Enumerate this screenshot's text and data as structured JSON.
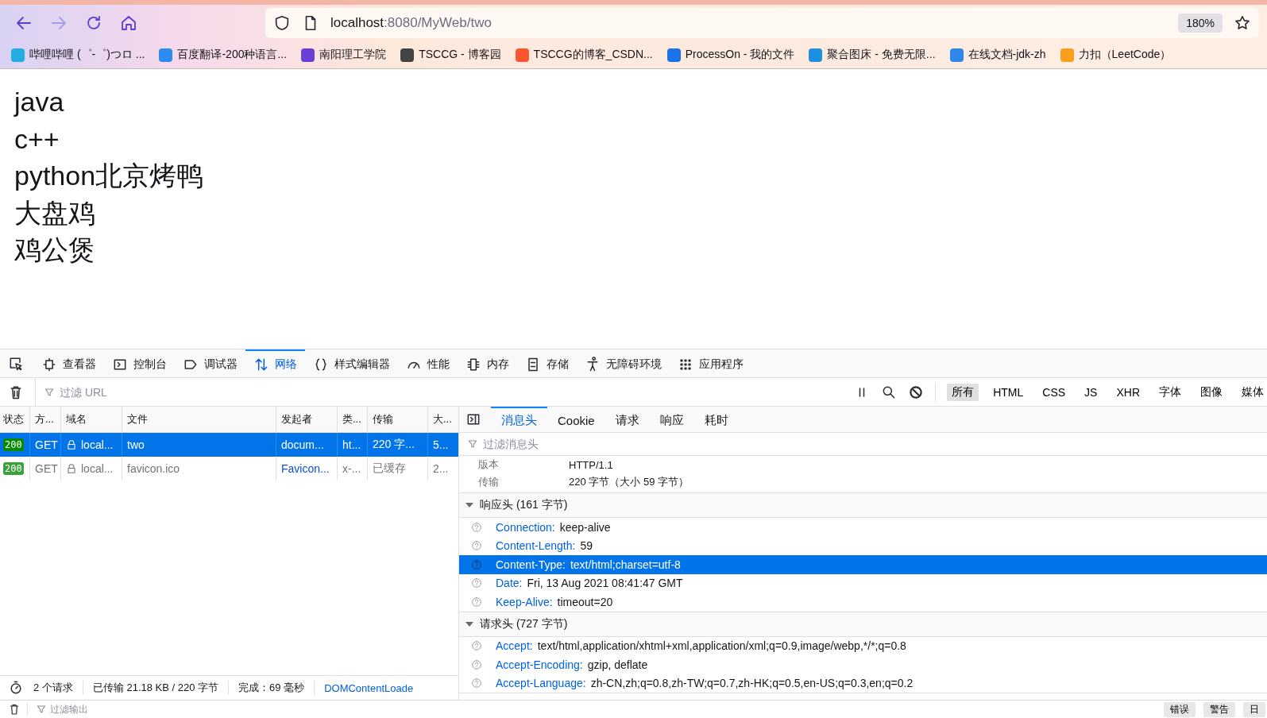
{
  "browser": {
    "nav": [
      {
        "kind": "back",
        "disabled": false
      },
      {
        "kind": "forward",
        "disabled": true
      },
      {
        "kind": "reload",
        "disabled": false
      },
      {
        "kind": "home",
        "disabled": false
      }
    ],
    "url": {
      "host": "localhost",
      "path": ":8080/MyWeb/two"
    },
    "zoom": "180%",
    "bookmarks": [
      "哔哩哔哩 (゜-゜)つロ ...",
      "百度翻译-200种语言...",
      "南阳理工学院",
      "TSCCG - 博客园",
      "TSCCG的博客_CSDN...",
      "ProcessOn - 我的文件",
      "聚合图床 - 免费无限...",
      "在线文档-jdk-zh",
      "力扣（LeetCode）"
    ]
  },
  "page": {
    "lines": [
      "java",
      "c++",
      "python北京烤鸭",
      "大盘鸡",
      "鸡公煲"
    ]
  },
  "devtools": {
    "tabs": [
      {
        "label": "查看器",
        "selected": false
      },
      {
        "label": "控制台",
        "selected": false
      },
      {
        "label": "调试器",
        "selected": false
      },
      {
        "label": "网络",
        "selected": true
      },
      {
        "label": "样式编辑器",
        "selected": false
      },
      {
        "label": "性能",
        "selected": false
      },
      {
        "label": "内存",
        "selected": false
      },
      {
        "label": "存储",
        "selected": false
      },
      {
        "label": "无障碍环境",
        "selected": false
      },
      {
        "label": "应用程序",
        "selected": false
      }
    ],
    "filter": {
      "placeholder": "过滤 URL"
    },
    "type_filters": [
      {
        "label": "所有",
        "selected": true
      },
      {
        "label": "HTML",
        "selected": false
      },
      {
        "label": "CSS",
        "selected": false
      },
      {
        "label": "JS",
        "selected": false
      },
      {
        "label": "XHR",
        "selected": false
      },
      {
        "label": "字体",
        "selected": false
      },
      {
        "label": "图像",
        "selected": false
      },
      {
        "label": "媒体",
        "selected": false
      }
    ],
    "columns": [
      "状态",
      "方...",
      "域名",
      "文件",
      "发起者",
      "类...",
      "传输",
      "大..."
    ],
    "requests": [
      {
        "status": "200",
        "method": "GET",
        "domain": "local...",
        "file": "two",
        "initiator": "docum...",
        "type": "ht...",
        "transfer": "220 字...",
        "size": "5...",
        "selected": true,
        "cached": false
      },
      {
        "status": "200",
        "method": "GET",
        "domain": "local...",
        "file": "favicon.ico",
        "initiator": "Favicon...",
        "type": "x-...",
        "transfer": "已缓存",
        "size": "2...",
        "selected": false,
        "cached": true
      }
    ],
    "status": {
      "requests": "2 个请求",
      "transferred": "已传输 21.18 KB / 220 字节",
      "finish": "完成：69 毫秒",
      "dom": "DOMContentLoade"
    },
    "details": {
      "tabs": [
        {
          "label": "消息头",
          "selected": true
        },
        {
          "label": "Cookie",
          "selected": false
        },
        {
          "label": "请求",
          "selected": false
        },
        {
          "label": "响应",
          "selected": false
        },
        {
          "label": "耗时",
          "selected": false
        }
      ],
      "filter": {
        "placeholder": "过滤消息头"
      },
      "summary": [
        {
          "label": "版本",
          "value": "HTTP/1.1"
        },
        {
          "label": "传输",
          "value": "220 字节（大小 59 字节）"
        }
      ],
      "sections": [
        {
          "title": "响应头 (161 字节)",
          "expanded": true,
          "headers": [
            {
              "name": "Connection:",
              "value": "keep-alive",
              "selected": false
            },
            {
              "name": "Content-Length:",
              "value": "59",
              "selected": false
            },
            {
              "name": "Content-Type:",
              "value": "text/html;charset=utf-8",
              "selected": true
            },
            {
              "name": "Date:",
              "value": "Fri, 13 Aug 2021 08:41:47 GMT",
              "selected": false
            },
            {
              "name": "Keep-Alive:",
              "value": "timeout=20",
              "selected": false
            }
          ]
        },
        {
          "title": "请求头 (727 字节)",
          "expanded": true,
          "headers": [
            {
              "name": "Accept:",
              "value": "text/html,application/xhtml+xml,application/xml;q=0.9,image/webp,*/*;q=0.8",
              "selected": false
            },
            {
              "name": "Accept-Encoding:",
              "value": "gzip, deflate",
              "selected": false
            },
            {
              "name": "Accept-Language:",
              "value": "zh-CN,zh;q=0.8,zh-TW;q=0.7,zh-HK;q=0.5,en-US;q=0.3,en;q=0.2",
              "selected": false
            }
          ]
        }
      ]
    },
    "console": {
      "placeholder": "过滤输出",
      "buttons": [
        "错误",
        "警告",
        "日"
      ]
    }
  }
}
